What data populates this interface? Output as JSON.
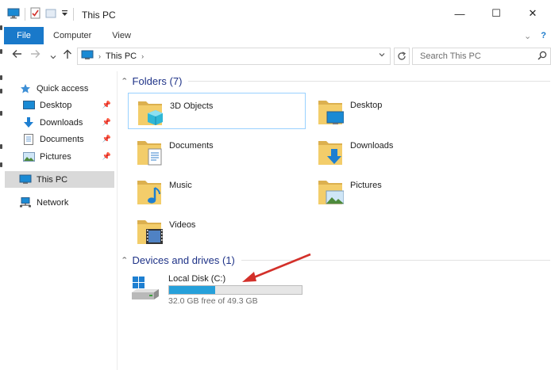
{
  "window": {
    "title": "This PC",
    "controls": {
      "minimize": "—",
      "maximize": "☐",
      "close": "✕"
    }
  },
  "ribbon": {
    "tabs": [
      {
        "label": "File"
      },
      {
        "label": "Computer"
      },
      {
        "label": "View"
      }
    ]
  },
  "address": {
    "crumb": "This PC",
    "search_placeholder": "Search This PC"
  },
  "nav": {
    "quick_access": "Quick access",
    "items": [
      {
        "label": "Desktop",
        "icon": "desktop-icon"
      },
      {
        "label": "Downloads",
        "icon": "downloads-icon"
      },
      {
        "label": "Documents",
        "icon": "documents-icon"
      },
      {
        "label": "Pictures",
        "icon": "pictures-icon"
      }
    ],
    "this_pc": "This PC",
    "network": "Network"
  },
  "folders": {
    "header": "Folders (7)",
    "items": [
      {
        "label": "3D Objects"
      },
      {
        "label": "Desktop"
      },
      {
        "label": "Documents"
      },
      {
        "label": "Downloads"
      },
      {
        "label": "Music"
      },
      {
        "label": "Pictures"
      },
      {
        "label": "Videos"
      }
    ]
  },
  "drives": {
    "header": "Devices and drives (1)",
    "items": [
      {
        "name": "Local Disk (C:)",
        "free_text": "32.0 GB free of 49.3 GB",
        "used_fraction": 0.35
      }
    ]
  },
  "colors": {
    "accent": "#1979ca",
    "group_header": "#1e3287",
    "drive_fill": "#26a0da",
    "annotation_arrow": "#d3302a"
  }
}
